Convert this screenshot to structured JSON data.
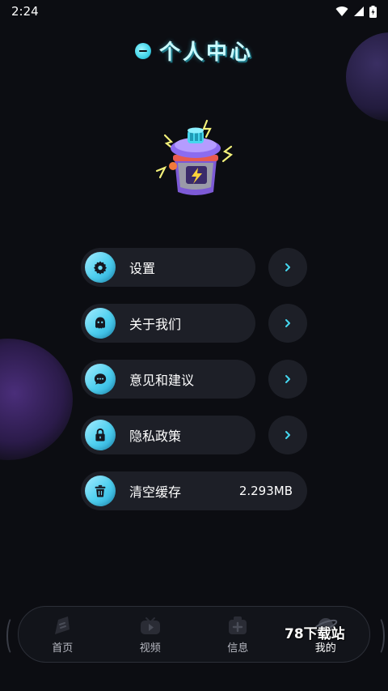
{
  "status_bar": {
    "time": "2:24"
  },
  "header": {
    "title": "个人中心"
  },
  "menu": [
    {
      "label": "设置",
      "icon": "gear-icon",
      "has_arrow": true
    },
    {
      "label": "关于我们",
      "icon": "ghost-icon",
      "has_arrow": true
    },
    {
      "label": "意见和建议",
      "icon": "chat-icon",
      "has_arrow": true
    },
    {
      "label": "隐私政策",
      "icon": "lock-icon",
      "has_arrow": true
    },
    {
      "label": "清空缓存",
      "icon": "trash-icon",
      "value": "2.293MB",
      "has_arrow": false
    }
  ],
  "tabs": [
    {
      "label": "首页",
      "icon": "home-icon",
      "active": false
    },
    {
      "label": "视频",
      "icon": "video-icon",
      "active": false
    },
    {
      "label": "信息",
      "icon": "info-icon",
      "active": false
    },
    {
      "label": "我的",
      "icon": "planet-icon",
      "active": true
    }
  ],
  "watermark": "78下载站",
  "colors": {
    "background": "#0c0d12",
    "pill": "#1d1f27",
    "accent": "#4ecfef"
  }
}
